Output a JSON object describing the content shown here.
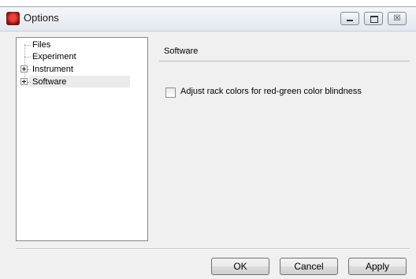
{
  "window": {
    "title": "Options",
    "controls": {
      "minimize_icon": "minimize-icon",
      "maximize_icon": "maximize-icon",
      "close_label": "☒"
    }
  },
  "tree": {
    "items": [
      {
        "label": "Files",
        "expandable": false
      },
      {
        "label": "Experiment",
        "expandable": false
      },
      {
        "label": "Instrument",
        "expandable": true
      },
      {
        "label": "Software",
        "expandable": true,
        "selected": true
      }
    ]
  },
  "panel": {
    "title": "Software",
    "checkbox": {
      "label": "Adjust rack colors for red-green color blindness",
      "checked": false
    }
  },
  "buttons": {
    "ok": "OK",
    "cancel": "Cancel",
    "apply": "Apply"
  }
}
